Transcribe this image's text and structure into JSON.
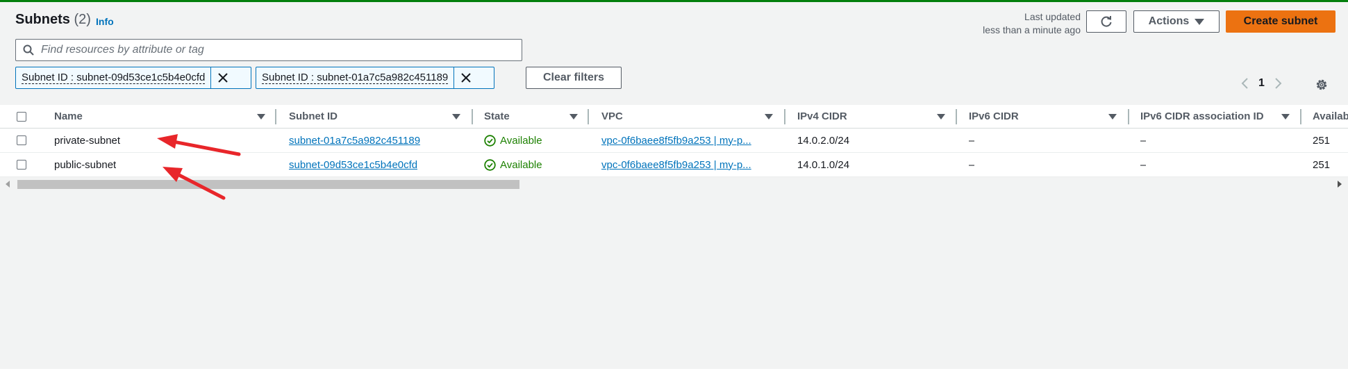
{
  "header": {
    "title": "Subnets",
    "count": "(2)",
    "info_label": "Info",
    "last_updated_line1": "Last updated",
    "last_updated_line2": "less than a minute ago",
    "actions_label": "Actions",
    "create_label": "Create subnet"
  },
  "search": {
    "placeholder": "Find resources by attribute or tag",
    "value": ""
  },
  "filters": [
    {
      "label": "Subnet ID : subnet-09d53ce1c5b4e0cfd"
    },
    {
      "label": "Subnet ID : subnet-01a7c5a982c451189"
    }
  ],
  "clear_filters_label": "Clear filters",
  "pagination": {
    "current_page": "1"
  },
  "table": {
    "columns": [
      "Name",
      "Subnet ID",
      "State",
      "VPC",
      "IPv4 CIDR",
      "IPv6 CIDR",
      "IPv6 CIDR association ID",
      "Availab"
    ],
    "rows": [
      {
        "name": "private-subnet",
        "subnet_id": "subnet-01a7c5a982c451189",
        "state": "Available",
        "vpc": "vpc-0f6baee8f5fb9a253 | my-p...",
        "ipv4": "14.0.2.0/24",
        "ipv6": "–",
        "ipv6_assoc": "–",
        "available": "251"
      },
      {
        "name": "public-subnet",
        "subnet_id": "subnet-09d53ce1c5b4e0cfd",
        "state": "Available",
        "vpc": "vpc-0f6baee8f5fb9a253 | my-p...",
        "ipv4": "14.0.1.0/24",
        "ipv6": "–",
        "ipv6_assoc": "–",
        "available": "251"
      }
    ]
  },
  "colors": {
    "accent": "#ec7211",
    "link": "#0073bb",
    "success": "#1d8102",
    "annotation_arrow": "#e8262a"
  }
}
